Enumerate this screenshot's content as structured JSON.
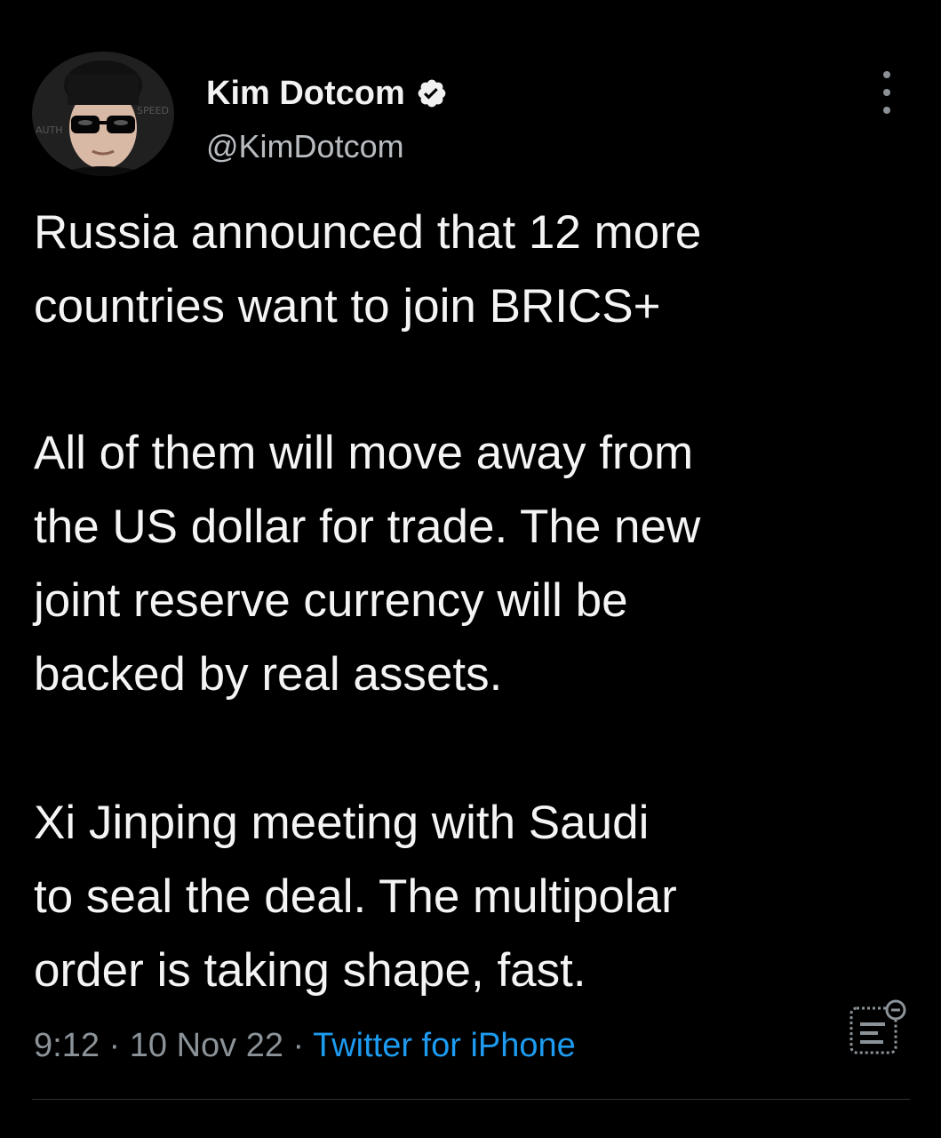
{
  "tweet": {
    "display_name": "Kim Dotcom",
    "handle": "@KimDotcom",
    "body": {
      "p1_line1": "Russia announced that 12 more",
      "p1_line2": "countries want to join BRICS+",
      "p2_line1": "All of them will move away from",
      "p2_line2": "the US dollar for trade. The new",
      "p2_line3": "joint reserve currency will be",
      "p2_line4": "backed by real assets.",
      "p3_line1": "Xi Jinping meeting with Saudi",
      "p3_line2": "to seal the deal. The multipolar",
      "p3_line3": "order is taking shape, fast."
    },
    "time": "9:12",
    "date": "10 Nov 22",
    "separator": "·",
    "source": "Twitter for iPhone",
    "avatar_text": {
      "a": "AUTH",
      "b": "SPEED"
    }
  },
  "icons": {
    "verified": "verified-badge-icon",
    "more": "more-options-icon",
    "analytics": "view-analytics-icon"
  },
  "colors": {
    "background": "#000000",
    "text": "#f4f4f4",
    "secondary": "#8b9399",
    "link": "#1d9bf0",
    "divider": "#2f3336"
  }
}
